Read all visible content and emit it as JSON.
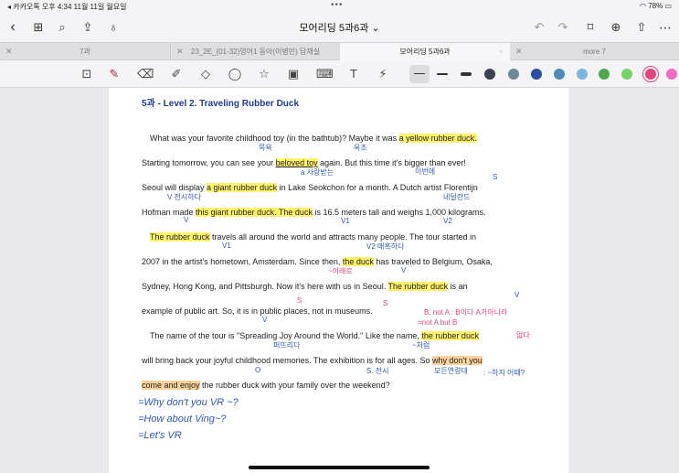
{
  "status_bar": {
    "left": "◂ 카카오톡  오후 4:34  11월 11일 월요일",
    "right": "78%"
  },
  "title_bar": {
    "title": "모어리딩 5과6과 ⌄"
  },
  "tabs": [
    {
      "label": "7과"
    },
    {
      "label": "23_2E_(01-32)영어1 동아(이병민) 답채실"
    },
    {
      "label": "모어리딩 5과6과"
    },
    {
      "label": "more 7"
    }
  ],
  "colors": {
    "swatches": [
      "#3b4250",
      "#6f8796",
      "#2a4fa0",
      "#4d8ab8",
      "#7bb6e0",
      "#4ea64f",
      "#7bd06b",
      "#e4437f",
      "#f06bc2"
    ],
    "heading": "#1f3a8a",
    "highlight": "#fff36a",
    "ink_blue": "#2d58b8",
    "ink_pink": "#e4437f"
  },
  "page": {
    "heading": "5과 - Level 2. Traveling Rubber Duck",
    "lines": {
      "l1a": "What was your favorite childhood toy (in the bathtub)? Maybe it was ",
      "l1b": "a yellow rubber duck.",
      "l2a": "Starting tomorrow, you can see your ",
      "l2b": "beloved toy",
      "l2c": " again. But this time it's bigger than ever!",
      "l3a": "Seoul will display ",
      "l3b": "a giant rubber duck",
      "l3c": " in Lake Seokchon for a month. A Dutch artist Florentijn",
      "l4a": "Hofman made ",
      "l4b": "this giant rubber duck. The duck",
      "l4c": " is 16.5 meters tall and weighs 1,000 kilograms.",
      "l5a": "The rubber duck",
      "l5b": " travels all around the world and attracts many people. The tour started in",
      "l6a": "2007 in the artist's hometown, Amsterdam. Since then, ",
      "l6b": "the duck",
      "l6c": " has traveled to Belgium, Osaka,",
      "l7a": "Sydney, Hong Kong, and Pittsburgh. Now it's here with us in Seoul. ",
      "l7b": "The rubber duck",
      "l7c": " is an",
      "l8": "example of public art. So, it is in public places, not in museums.",
      "l9a": "The name of the tour is \"Spreading Joy Around the World.\" Like the name, ",
      "l9b": "the rubber duck",
      "l10a": "will bring back your joyful childhood memories. The exhibition is for all ages. So ",
      "l10b": "why don't you",
      "l11a": "come and enjoy",
      "l11b": " the rubber duck with your family over the weekend?"
    },
    "annotations": {
      "a1": "목욕",
      "a2": "욕조",
      "a3": "이번에",
      "a4": "a.사랑받는",
      "a5": "S",
      "a6": "V 전시하다",
      "a7": "V",
      "a8": "네덜란드",
      "a9": "V1",
      "a10": "V2",
      "a11": "V1",
      "a12": "V2 매혹하다",
      "a13": "~이래로",
      "a14": "V",
      "a15": "S",
      "a16": "V",
      "a17": "S",
      "a18": "V",
      "a19": "퍼뜨리다",
      "a20": "~처럼",
      "a21": "O",
      "a22": "S. 전시",
      "a23": "모든연령대",
      "a24": ": ~하지 어때?",
      "pink1": "B, not A : B이다 A가아니라",
      "pink2": "=not A but B",
      "pink3": "없다"
    },
    "handwriting": {
      "h1": "=Why don't you VR ~?",
      "h2": "=How about Ving~?",
      "h3": "=Let's VR"
    }
  }
}
